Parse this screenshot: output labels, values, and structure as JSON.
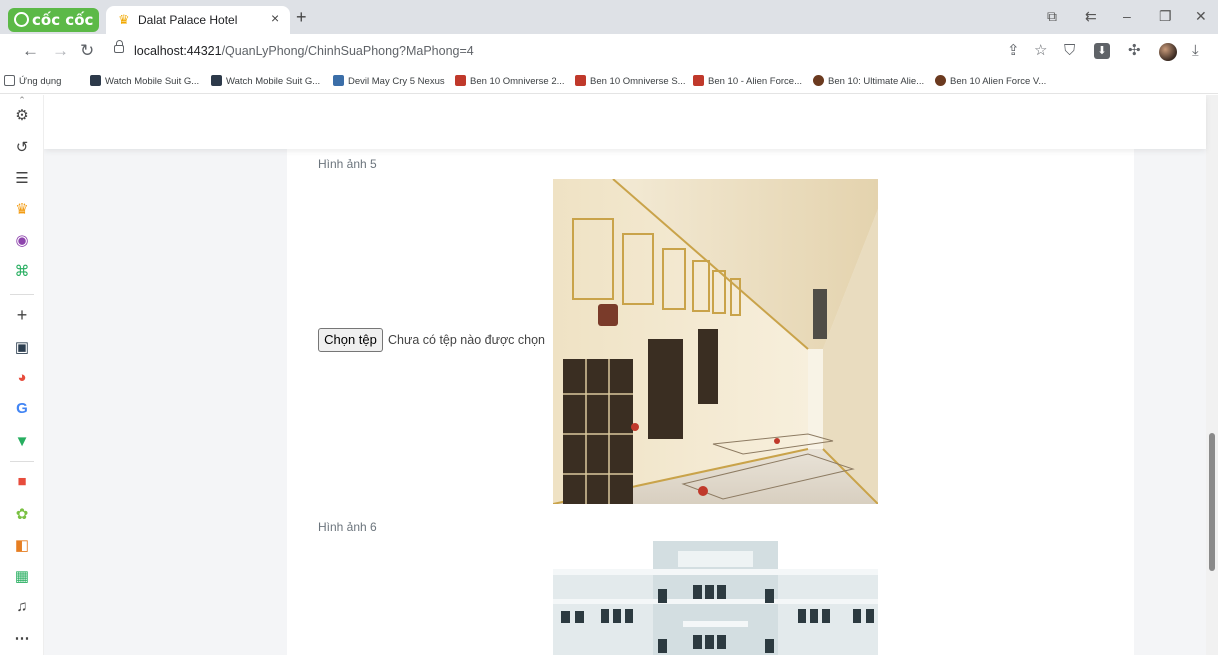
{
  "browser": {
    "brand": "cốc cốc",
    "tab_title": "Dalat Palace Hotel",
    "tab_close": "×",
    "new_tab": "+",
    "url_host": "localhost:44321",
    "url_path": "/QuanLyPhong/ChinhSuaPhong?MaPhong=4"
  },
  "bookmarks": [
    {
      "label": "Ứng dụng",
      "color": "#5f6368"
    },
    {
      "label": "Watch Mobile Suit G...",
      "color": "#2d3a4a"
    },
    {
      "label": "Watch Mobile Suit G...",
      "color": "#2d3a4a"
    },
    {
      "label": "Devil May Cry 5 Nexus",
      "color": "#3b6ea8"
    },
    {
      "label": "Ben 10 Omniverse 2...",
      "color": "#c0392b"
    },
    {
      "label": "Ben 10 Omniverse S...",
      "color": "#c0392b"
    },
    {
      "label": "Ben 10 - Alien Force...",
      "color": "#c0392b"
    },
    {
      "label": "Ben 10: Ultimate Alie...",
      "color": "#6b3a1f"
    },
    {
      "label": "Ben 10 Alien Force V...",
      "color": "#6b3a1f"
    }
  ],
  "form": {
    "image5_label": "Hình ảnh 5",
    "image6_label": "Hình ảnh 6",
    "file_button": "Chọn tệp",
    "file_status": "Chưa có tệp nào được chọn"
  }
}
